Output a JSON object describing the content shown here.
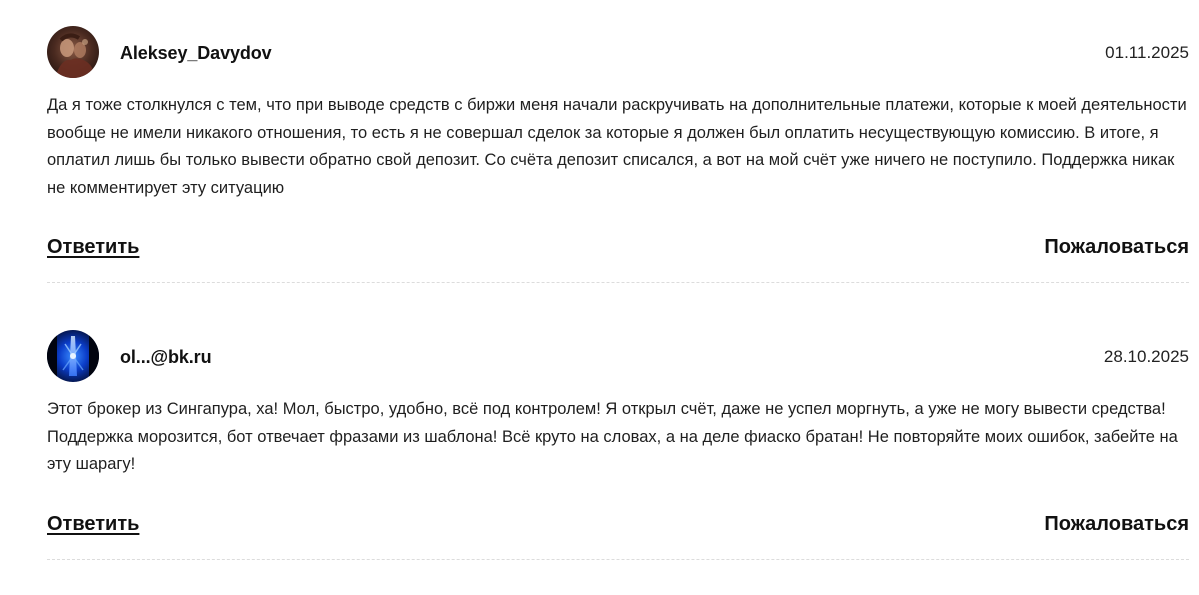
{
  "comments": [
    {
      "author": "Aleksey_Davydov",
      "date": "01.11.2025",
      "avatar_icon": "user-photo-avatar",
      "text": "Да я тоже столкнулся с тем, что при выводе средств с биржи меня начали раскручивать на дополнительные платежи, которые к моей деятельности вообще не имели никакого отношения, то есть я не совершал сделок за которые я должен был оплатить несуществующую комиссию. В итоге, я оплатил лишь бы только вывести обратно свой депозит. Со счёта депозит списался, а вот на мой счёт уже ничего не поступило. Поддержка никак не комментирует эту ситуацию",
      "reply_label": "Ответить",
      "report_label": "Пожаловаться"
    },
    {
      "author": "ol...@bk.ru",
      "date": "28.10.2025",
      "avatar_icon": "user-photo-avatar",
      "text": "Этот брокер из Сингапура, ха! Мол, быстро, удобно, всё под контролем! Я открыл счёт, даже не успел моргнуть, а уже не могу вывести средства! Поддержка морозится, бот отвечает фразами из шаблона! Всё круто на словах, а на деле фиаско братан! Не повторяйте моих ошибок, забейте на эту шарагу!",
      "reply_label": "Ответить",
      "report_label": "Пожаловаться"
    }
  ],
  "colors": {
    "text": "#1f1f1f",
    "divider": "#dcdcdc",
    "background": "#ffffff"
  }
}
